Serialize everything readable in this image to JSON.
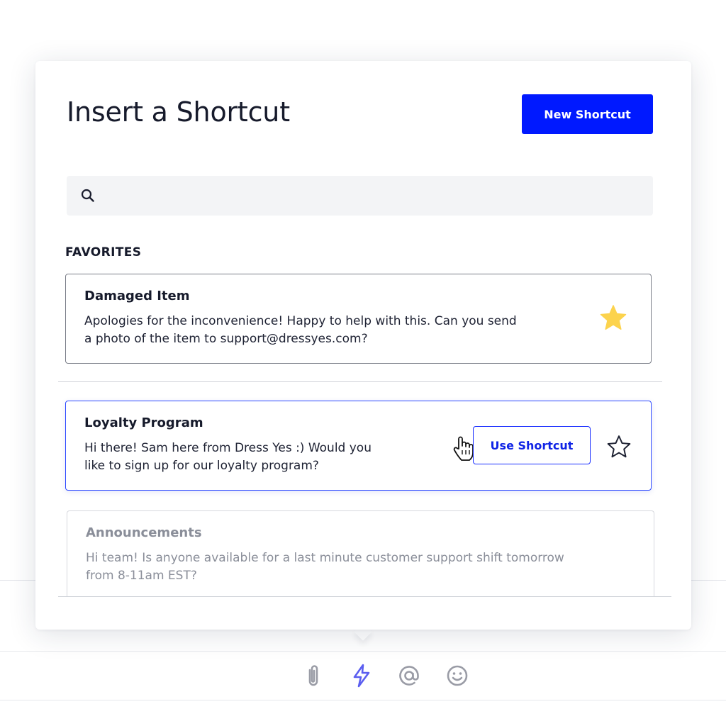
{
  "popover": {
    "title": "Insert a Shortcut",
    "new_button_label": "New Shortcut"
  },
  "search": {
    "placeholder": "",
    "value": "",
    "icon": "search-icon"
  },
  "favorites": {
    "label": "FAVORITES",
    "items": [
      {
        "title": "Damaged Item",
        "body_lines": [
          "Apologies for the inconvenience! Happy to help with this. Can you send",
          "a photo of the item to support@dressyes.com?"
        ],
        "starred": true,
        "star_icon": "star-filled-icon"
      }
    ]
  },
  "shortcuts": {
    "items": [
      {
        "title": "Loyalty Program",
        "body_lines": [
          "Hi there! Sam here from Dress Yes :)  Would you",
          "like to sign up for our loyalty program?"
        ],
        "starred": false,
        "hovered": true,
        "action_label": "Use Shortcut",
        "star_icon": "star-outline-icon"
      },
      {
        "title": "Announcements",
        "body_lines": [
          "Hi team! Is anyone available for a last minute customer support shift tomorrow",
          "from 8-11am EST?"
        ],
        "starred": false,
        "hovered": false
      }
    ]
  },
  "toolbar": {
    "icons": [
      "paperclip-icon",
      "lightning-icon",
      "at-sign-icon",
      "smiley-icon"
    ],
    "active_icon": "lightning-icon"
  },
  "colors": {
    "accent": "#0019ff",
    "active_border": "#2f4bff",
    "star_filled": "#fcd34d",
    "toolbar_icon": "#9a9ca6",
    "toolbar_active": "#5b5ef0"
  }
}
